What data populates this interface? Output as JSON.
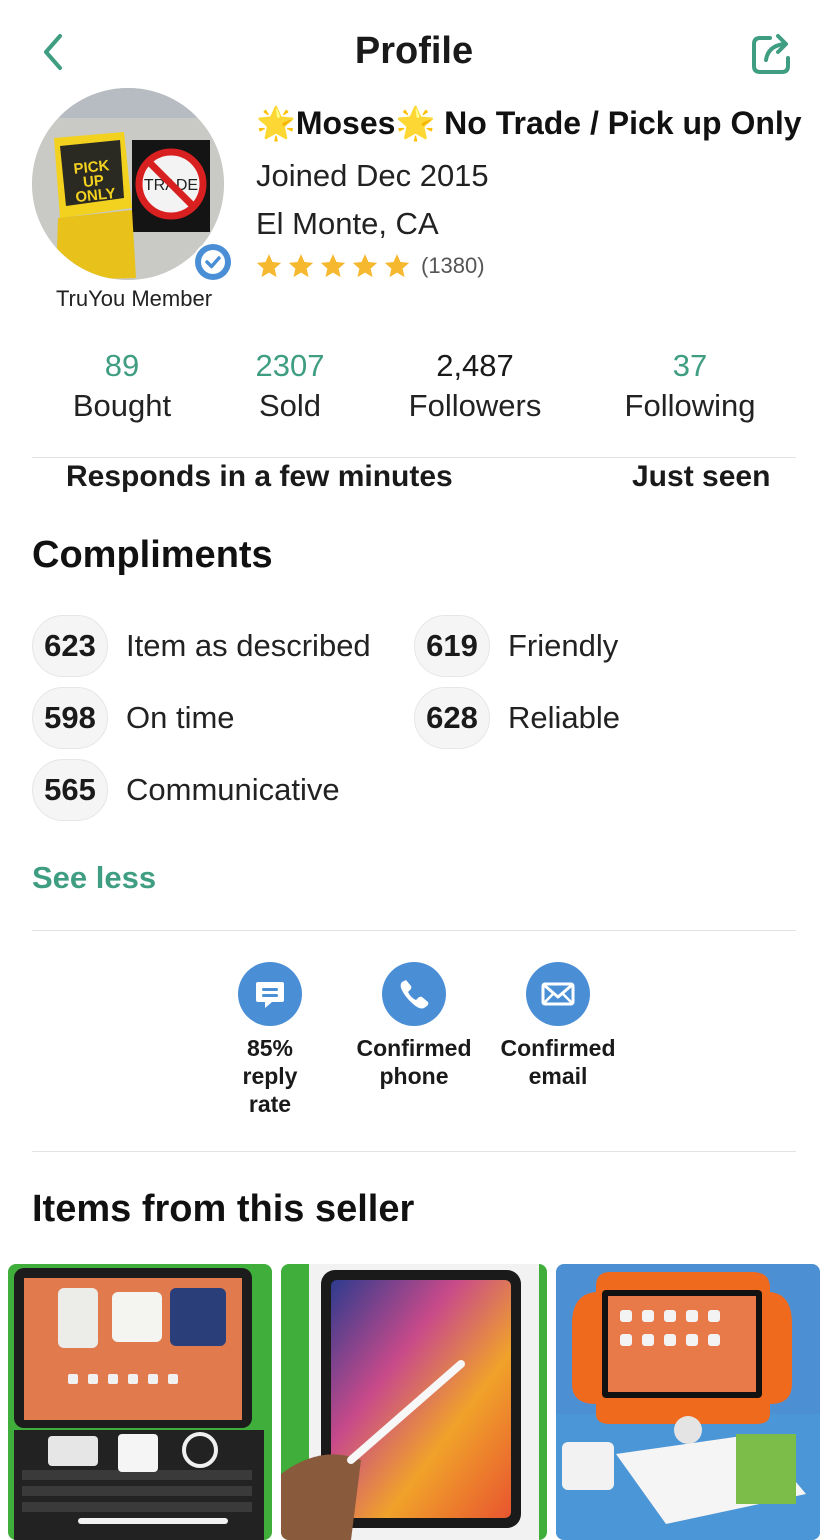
{
  "header": {
    "title": "Profile"
  },
  "profile": {
    "name": "🌟Moses🌟 No Trade / Pick up Only",
    "joined": "Joined Dec 2015",
    "location": "El Monte, CA",
    "rating": 5,
    "rating_count": "(1380)",
    "truyou_label": "TruYou Member",
    "avatar_text": {
      "sign1": "PICK UP ONLY",
      "sign2": "TRADE"
    }
  },
  "stats": [
    {
      "value": "89",
      "label": "Bought"
    },
    {
      "value": "2307",
      "label": "Sold"
    },
    {
      "value": "2,487",
      "label": "Followers"
    },
    {
      "value": "37",
      "label": "Following"
    }
  ],
  "activity": {
    "responds": "Responds in a few minutes",
    "last_seen": "Just seen"
  },
  "compliments": {
    "title": "Compliments",
    "items": [
      {
        "count": "623",
        "label": "Item as described"
      },
      {
        "count": "619",
        "label": "Friendly"
      },
      {
        "count": "598",
        "label": "On time"
      },
      {
        "count": "628",
        "label": "Reliable"
      },
      {
        "count": "565",
        "label": "Communicative"
      }
    ],
    "toggle_label": "See less"
  },
  "verifications": [
    {
      "icon": "chat-bubble-icon",
      "label": "85%\nreply\nrate"
    },
    {
      "icon": "phone-icon",
      "label": "Confirmed\nphone"
    },
    {
      "icon": "envelope-icon",
      "label": "Confirmed\nemail"
    }
  ],
  "items_section": {
    "title": "Items from this seller"
  },
  "colors": {
    "accent_green": "#3f9e82",
    "verify_blue": "#4a8fd6",
    "star_gold": "#f5b82e"
  }
}
